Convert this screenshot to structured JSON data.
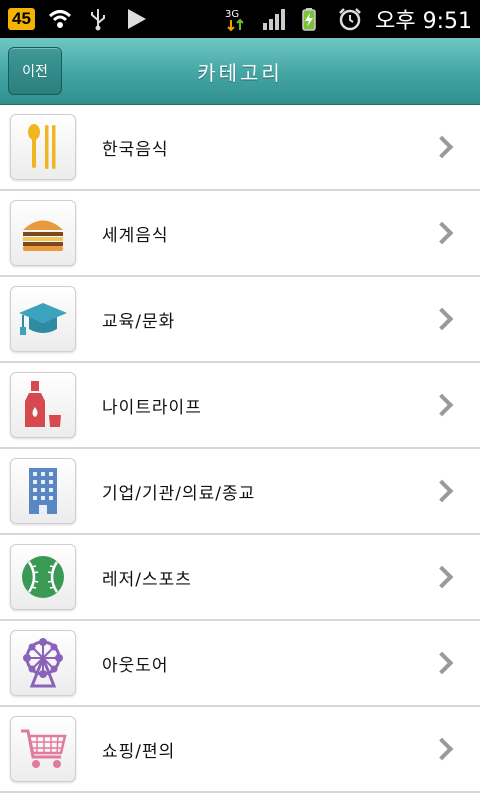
{
  "status_bar": {
    "battery_level": "45",
    "network_type": "3G",
    "time": "오후 9:51",
    "icons": [
      "battery-level-icon",
      "wifi-icon",
      "usb-icon",
      "play-icon",
      "network-3g-icon",
      "signal-icon",
      "battery-charging-icon",
      "alarm-icon"
    ]
  },
  "header": {
    "back_label": "이전",
    "title": "카테고리"
  },
  "categories": [
    {
      "label": "한국음식",
      "icon": "spoon-chopsticks-icon"
    },
    {
      "label": "세계음식",
      "icon": "burger-icon"
    },
    {
      "label": "교육/문화",
      "icon": "graduation-cap-icon"
    },
    {
      "label": "나이트라이프",
      "icon": "bottle-glass-icon"
    },
    {
      "label": "기업/기관/의료/종교",
      "icon": "office-building-icon"
    },
    {
      "label": "레저/스포츠",
      "icon": "baseball-icon"
    },
    {
      "label": "아웃도어",
      "icon": "ferris-wheel-icon"
    },
    {
      "label": "쇼핑/편의",
      "icon": "shopping-cart-icon"
    }
  ],
  "colors": {
    "header_teal": "#46a8a6",
    "status_bar_bg": "#000000",
    "divider": "#d8d8d8"
  }
}
